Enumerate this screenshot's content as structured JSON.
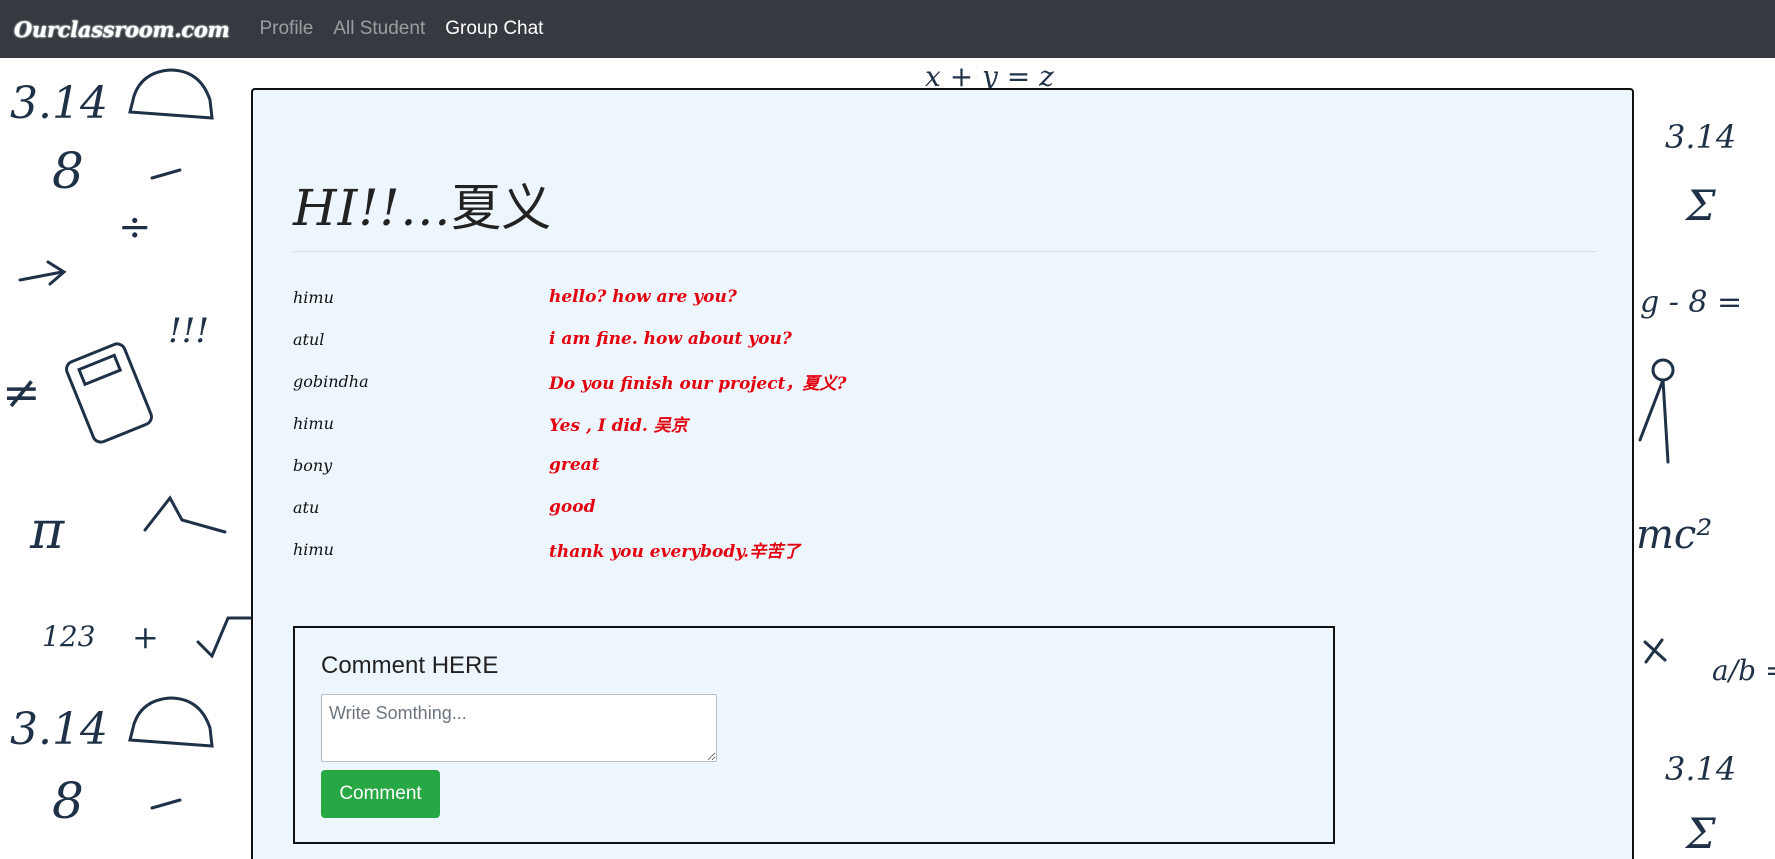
{
  "navbar": {
    "brand": "Ourclassroom.com",
    "links": [
      {
        "label": "Profile",
        "active": false
      },
      {
        "label": "All Student",
        "active": false
      },
      {
        "label": "Group Chat",
        "active": true
      }
    ]
  },
  "chat": {
    "greeting_prefix": "HI!!...",
    "greeting_name": "夏义",
    "messages": [
      {
        "user": "himu",
        "text": "hello? how are you?"
      },
      {
        "user": "atul",
        "text": "i am fine. how about you?"
      },
      {
        "user": "gobindha",
        "text": "Do you finish our project，夏义?"
      },
      {
        "user": "himu",
        "text": "Yes , I did. 吴京"
      },
      {
        "user": "bony",
        "text": "great"
      },
      {
        "user": "atu",
        "text": "good"
      },
      {
        "user": "himu",
        "text": "thank you everybody.辛苦了"
      }
    ]
  },
  "comment": {
    "title": "Comment HERE",
    "placeholder": "Write Somthing...",
    "button_label": "Comment"
  },
  "colors": {
    "navbar_bg": "#343a40",
    "card_bg": "#eef6fd",
    "message_text": "#e3000f",
    "button_bg": "#28a745"
  },
  "background": {
    "doodles": [
      "3.14",
      "8",
      "÷",
      "!!!",
      "≠",
      "π",
      "123",
      "+",
      "x + y = z",
      "Σ",
      "g - 8 =",
      "mc²",
      "a/b ="
    ]
  }
}
